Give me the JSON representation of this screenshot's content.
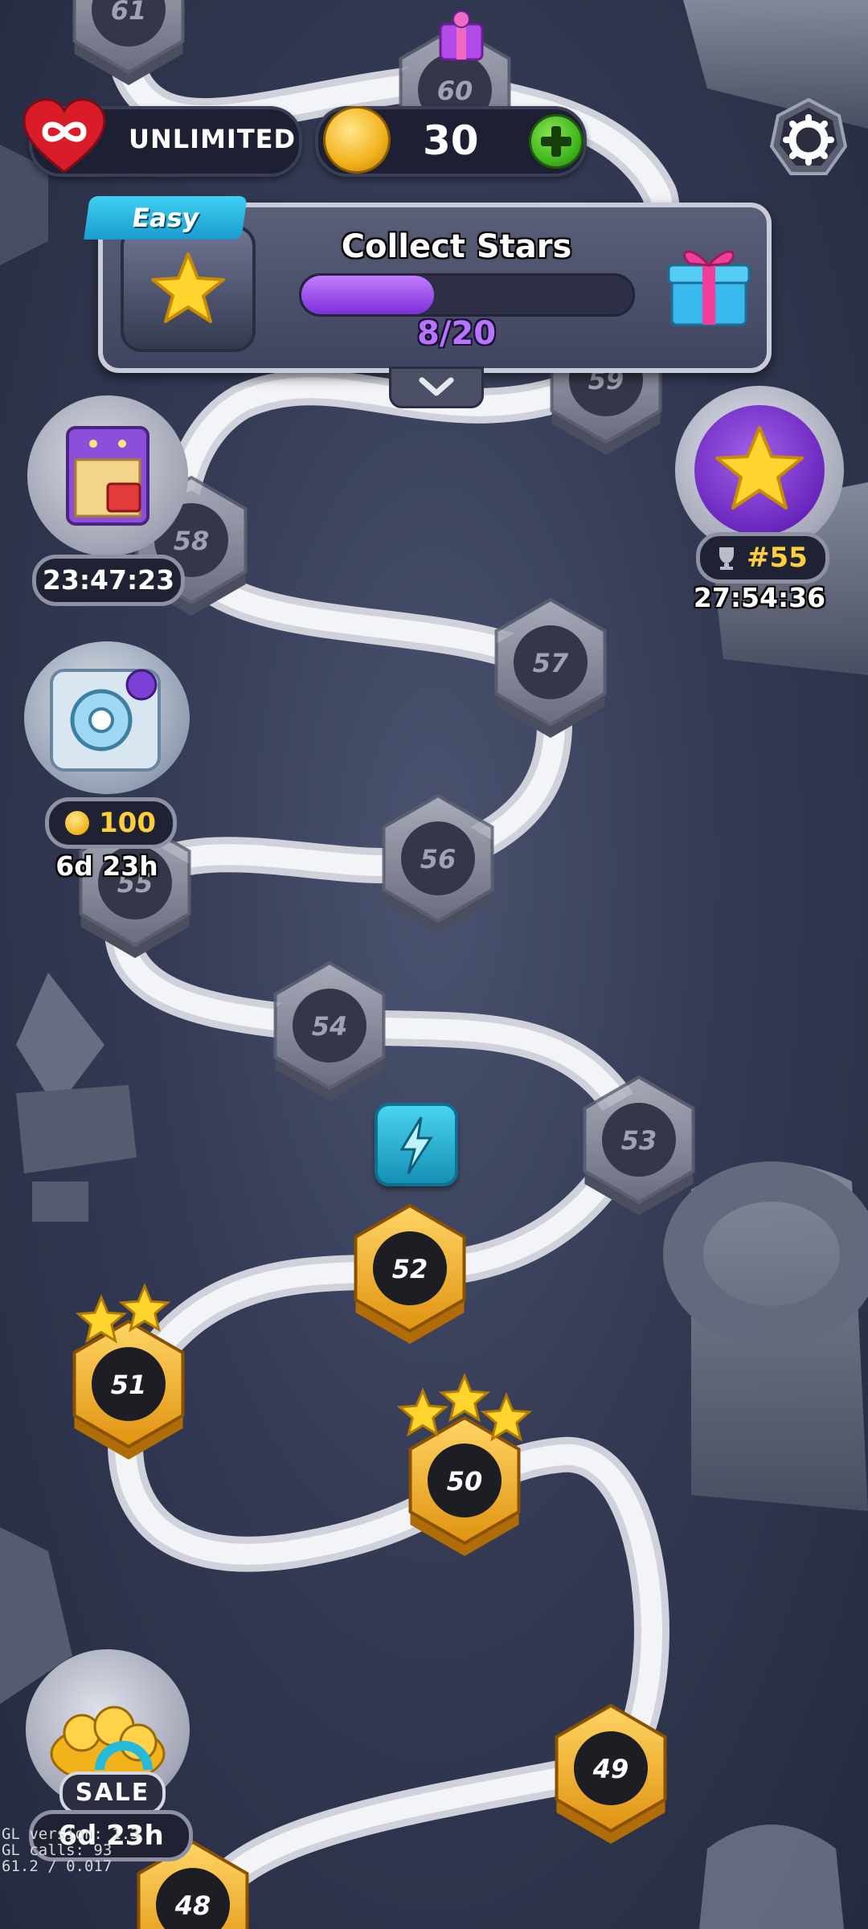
{
  "hud": {
    "lives_label": "UNLIMITED",
    "coins": "30"
  },
  "quest": {
    "difficulty": "Easy",
    "title": "Collect Stars",
    "progress_text": "8/20",
    "progress": 0.4
  },
  "side_events": {
    "ticket_timer": "23:47:23",
    "vault_cost": "100",
    "vault_timer": "6d 23h",
    "leaderboard_rank": "#55",
    "leaderboard_timer": "27:54:36",
    "sale_label": "SALE",
    "sale_timer": "6d 23h"
  },
  "levels": [
    {
      "number": "48",
      "state": "completed",
      "stars": 0
    },
    {
      "number": "49",
      "state": "completed",
      "stars": 0
    },
    {
      "number": "50",
      "state": "completed",
      "stars": 3
    },
    {
      "number": "51",
      "state": "completed",
      "stars": 2
    },
    {
      "number": "52",
      "state": "current",
      "stars": 0
    },
    {
      "number": "53",
      "state": "locked",
      "stars": 0
    },
    {
      "number": "54",
      "state": "locked",
      "stars": 0
    },
    {
      "number": "55",
      "state": "locked",
      "stars": 0
    },
    {
      "number": "56",
      "state": "locked",
      "stars": 0
    },
    {
      "number": "57",
      "state": "locked",
      "stars": 0
    },
    {
      "number": "58",
      "state": "locked",
      "stars": 0
    },
    {
      "number": "59",
      "state": "locked",
      "stars": 0
    },
    {
      "number": "60",
      "state": "locked",
      "stars": 0
    },
    {
      "number": "61",
      "state": "locked",
      "stars": 0
    }
  ],
  "debug_overlay": [
    "GL version: 1.3",
    "GL calls: 93",
    "61.2 / 0.017"
  ],
  "colors": {
    "gold": "#f2b21b",
    "purple": "#8a3fe0",
    "green": "#43b81f",
    "cyan": "#1eb4d9",
    "heart": "#d91b2a"
  }
}
